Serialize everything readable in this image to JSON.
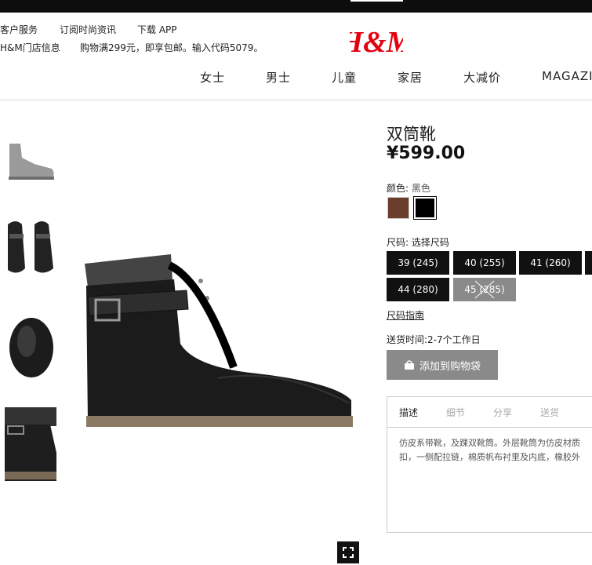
{
  "header": {
    "utility_links": [
      "客户服务",
      "订阅时尚资讯",
      "下载 APP"
    ],
    "store_info": "H&M门店信息",
    "promo": "购物满299元，即享包邮。输入代码5079。",
    "logo_text": "H&M",
    "nav": [
      "女士",
      "男士",
      "儿童",
      "家居",
      "大减价",
      "MAGAZINE"
    ]
  },
  "product": {
    "title": "双筒靴",
    "price": "¥599.00",
    "color_label": "颜色:",
    "color_value": "黑色",
    "colors": [
      "#6b3e2c",
      "#000000"
    ],
    "size_label": "尺码:",
    "size_value": "选择尺码",
    "sizes": [
      {
        "label": "39 (245)",
        "available": true
      },
      {
        "label": "40 (255)",
        "available": true
      },
      {
        "label": "41 (260)",
        "available": true
      },
      {
        "label": "44 (280)",
        "available": true
      },
      {
        "label": "45 (285)",
        "available": false
      }
    ],
    "size_guide": "尺码指南",
    "delivery": "送货时间:2-7个工作日",
    "add_to_bag": "添加到购物袋",
    "tabs": [
      "描述",
      "细节",
      "分享",
      "送货"
    ],
    "description_lines": [
      "仿皮系带靴，及踝双靴筒。外层靴筒为仿皮材质",
      "扣，一侧配拉链，棉质帆布衬里及内底，橡胶外"
    ]
  }
}
